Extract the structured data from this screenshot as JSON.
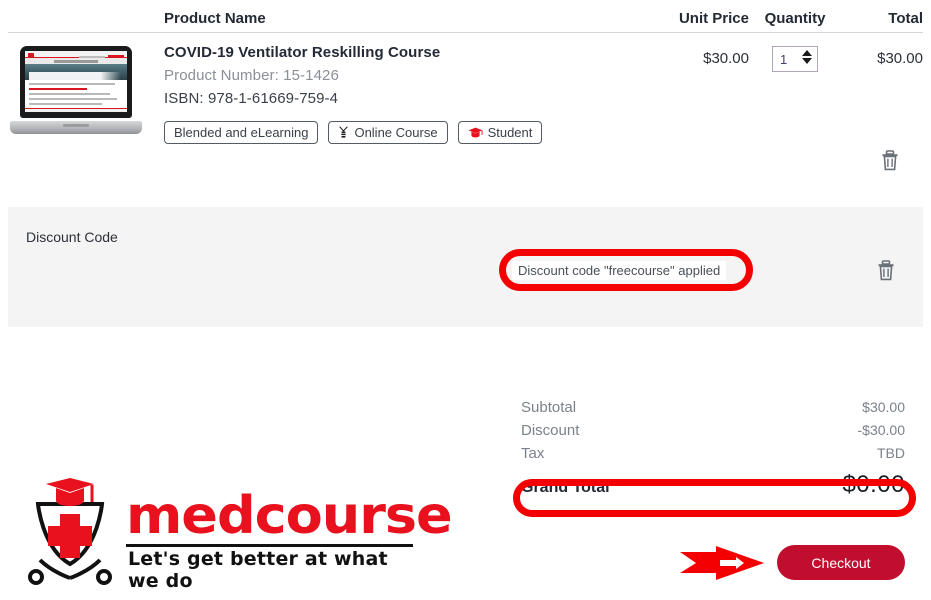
{
  "table": {
    "headers": {
      "product_name": "Product Name",
      "unit_price": "Unit Price",
      "quantity": "Quantity",
      "total": "Total"
    }
  },
  "product": {
    "title": "COVID-19 Ventilator Reskilling Course",
    "product_number": "Product Number: 15-1426",
    "isbn": "ISBN: 978-1-61669-759-4",
    "thumbnail_alt": "laptop-course-preview",
    "tags": [
      {
        "label": "Blended and eLearning",
        "icon": ""
      },
      {
        "label": "Online Course",
        "icon": "online-course-icon"
      },
      {
        "label": "Student",
        "icon": "graduation-cap-icon"
      }
    ],
    "unit_price": "$30.00",
    "quantity": "1",
    "line_total": "$30.00",
    "remove_icon": "trash-icon"
  },
  "discount": {
    "label": "Discount Code",
    "applied_message": "Discount code \"freecourse\" applied",
    "remove_icon": "trash-icon"
  },
  "totals": [
    {
      "label": "Subtotal",
      "value": "$30.00"
    },
    {
      "label": "Discount",
      "value": "-$30.00"
    },
    {
      "label": "Tax",
      "value": "TBD"
    },
    {
      "label": "Grand Total",
      "value": "$0.00"
    }
  ],
  "logo": {
    "wordmark": "medcourse",
    "tagline": "Let's get better at what we do",
    "mark": "shield-graduation-cap-icon"
  },
  "actions": {
    "checkout_label": "Checkout"
  },
  "annotations": {
    "discount_highlight": "red-rounded-highlight",
    "grand_total_highlight": "red-rounded-highlight",
    "checkout_pointer": "red-arrow-icon"
  },
  "colors": {
    "brand_red": "#e8111d",
    "checkout_red": "#c20e2e",
    "annotation_red": "#f50000",
    "panel_gray": "#f4f4f4",
    "muted_text": "#8a8f98"
  }
}
